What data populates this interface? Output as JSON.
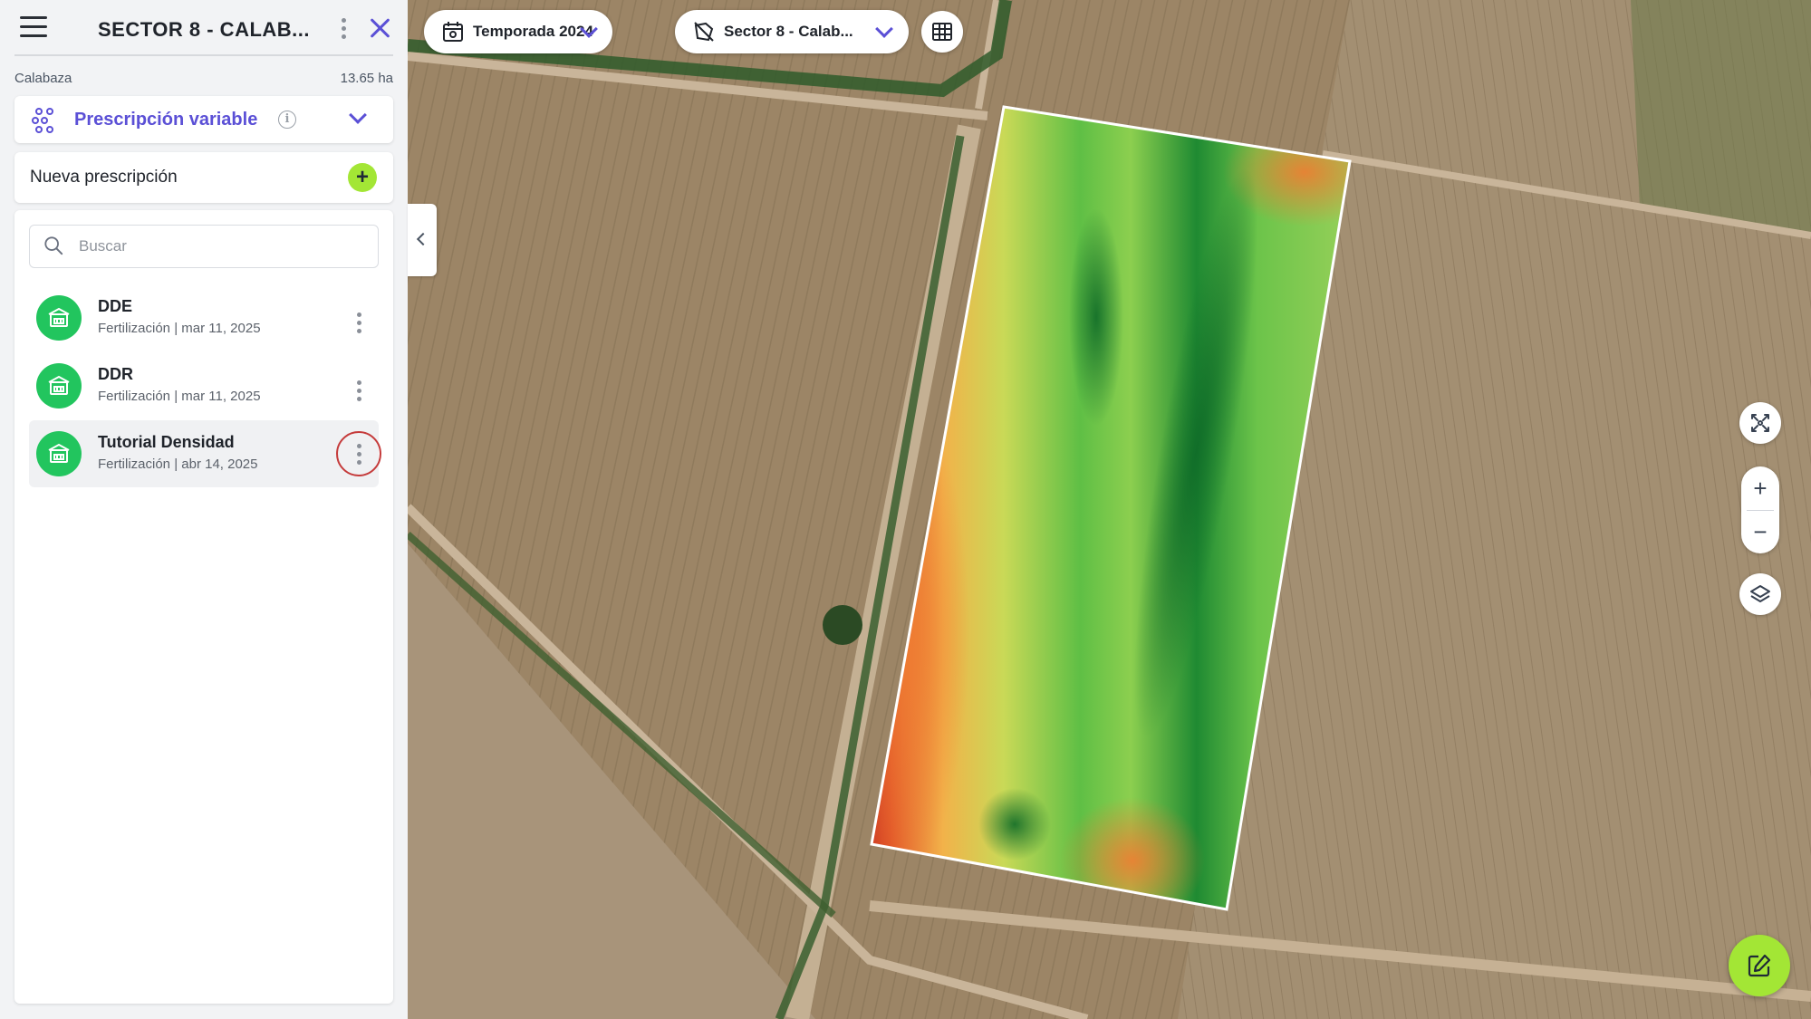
{
  "sidebar": {
    "title": "SECTOR 8 - CALAB...",
    "crop_name": "Calabaza",
    "area": "13.65 ha",
    "mode": {
      "label": "Prescripción variable",
      "info_glyph": "i"
    },
    "new_prescription": {
      "label": "Nueva prescripción",
      "add_glyph": "+"
    },
    "search": {
      "placeholder": "Buscar",
      "value": ""
    },
    "items": [
      {
        "name": "DDE",
        "subtitle": "Fertilización | mar 11, 2025"
      },
      {
        "name": "DDR",
        "subtitle": "Fertilización | mar 11, 2025"
      },
      {
        "name": "Tutorial Densidad",
        "subtitle": "Fertilización | abr 14, 2025"
      }
    ]
  },
  "toolbar": {
    "season": "Temporada 2024",
    "field": "Sector 8 - Calab..."
  },
  "map_controls": {
    "zoom_in": "+",
    "zoom_out": "−"
  },
  "colors": {
    "accent": "#5b50d6",
    "action_green": "#a3e635",
    "avatar_green": "#22c55e",
    "highlight_red": "#c53b3b"
  },
  "icons": [
    "menu-icon",
    "more-vertical-icon",
    "close-icon",
    "prescription-nodes-icon",
    "info-icon",
    "chevron-down-icon",
    "plus-icon",
    "search-icon",
    "tractor-icon",
    "chevron-left-icon",
    "calendar-icon",
    "field-outline-icon",
    "table-grid-icon",
    "fit-bounds-icon",
    "layers-icon",
    "edit-icon"
  ]
}
